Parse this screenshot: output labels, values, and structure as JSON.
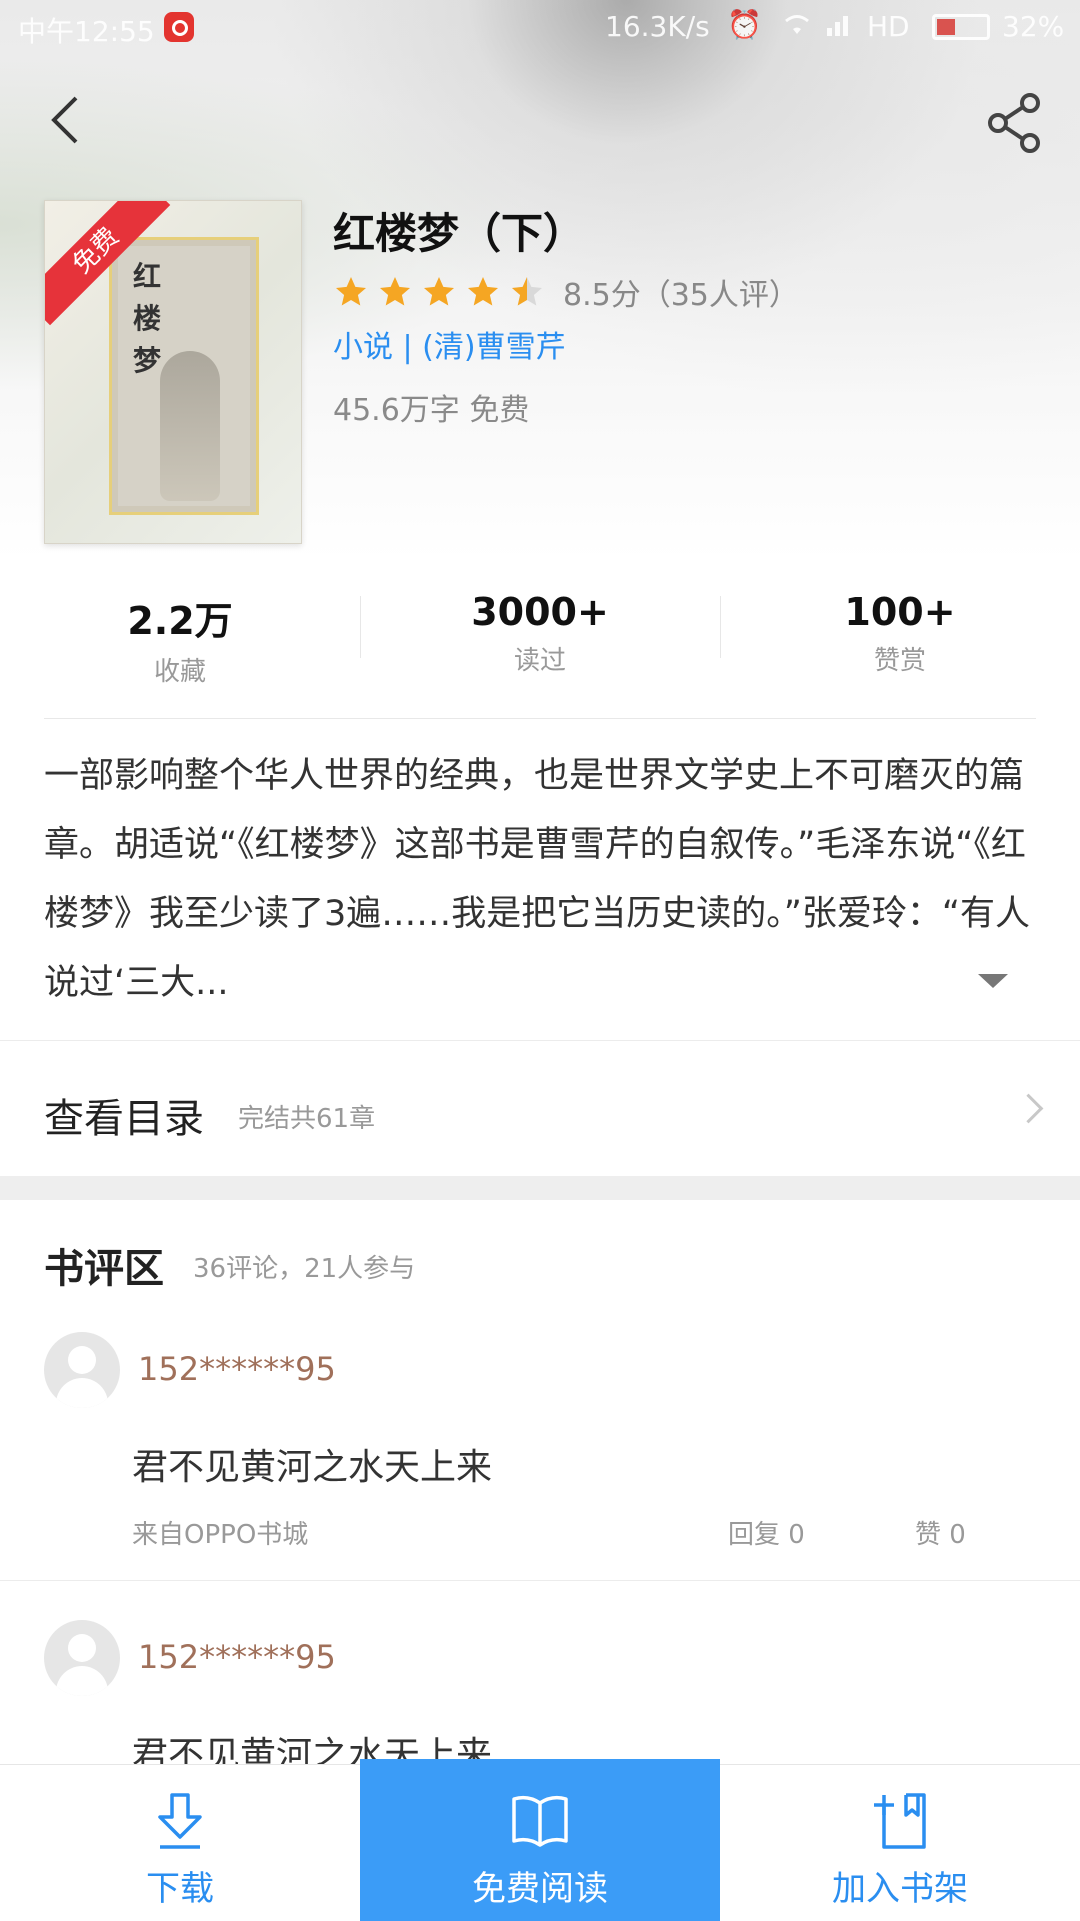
{
  "status_bar": {
    "time": "中午12:55",
    "network_speed": "16.3K/s",
    "network_type": "HD",
    "battery": "32%"
  },
  "book": {
    "cover_badge": "免费",
    "cover_title": "红楼梦",
    "title": "红楼梦（下）",
    "rating_stars": 4.5,
    "rating_text": "8.5分（35人评）",
    "category_author": "小说 | (清)曹雪芹",
    "meta": "45.6万字  免费"
  },
  "stats": [
    {
      "value": "2.2万",
      "label": "收藏"
    },
    {
      "value": "3000+",
      "label": "读过"
    },
    {
      "value": "100+",
      "label": "赞赏"
    }
  ],
  "intro": "一部影响整个华人世界的经典，也是世界文学史上不可磨灭的篇章。胡适说“《红楼梦》这部书是曹雪芹的自叙传。”毛泽东说“《红楼梦》我至少读了3遍……我是把它当历史读的。”张爱玲：“有人说过‘三大...",
  "toc": {
    "title": "查看目录",
    "subtitle": "完结共61章"
  },
  "reviews": {
    "title": "书评区",
    "subtitle": "36评论，21人参与",
    "items": [
      {
        "user": "152******95",
        "text": "君不见黄河之水天上来",
        "source": "来自OPPO书城",
        "reply": "回复  0",
        "like": "赞  0"
      },
      {
        "user": "152******95",
        "text": "君不见黄河之水天上来"
      }
    ]
  },
  "bottom_bar": {
    "download": "下载",
    "read_free": "免费阅读",
    "add_shelf": "加入书架"
  },
  "colors": {
    "accent": "#2a8ef0",
    "primary_button": "#3b9cf7",
    "star": "#f5a623",
    "badge": "#e6333a",
    "username": "#a0705a"
  },
  "icons": [
    "back-icon",
    "share-icon",
    "star-icon",
    "expand-arrow-icon",
    "chevron-right-icon",
    "download-icon",
    "book-open-icon",
    "add-bookshelf-icon"
  ]
}
